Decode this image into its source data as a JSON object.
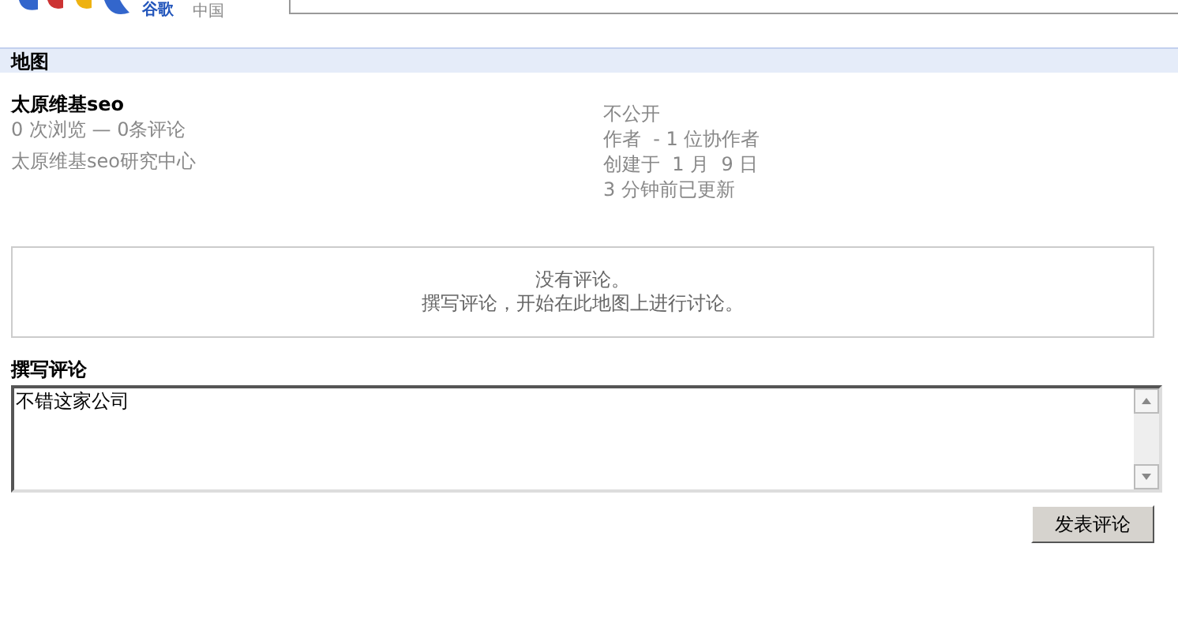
{
  "header": {
    "logo_sub": "谷歌",
    "region": "中国"
  },
  "section_title": "地图",
  "map": {
    "title": "太原维基seo",
    "stats": "0 次浏览 — 0条评论",
    "description": "太原维基seo研究中心",
    "visibility": "不公开",
    "author": "作者  - 1 位协作者",
    "created": "创建于  1 月  9 日",
    "updated": "3 分钟前已更新"
  },
  "comments": {
    "empty_lines": [
      "没有评论。",
      "撰写评论，开始在此地图上进行讨论。"
    ]
  },
  "compose": {
    "heading": "撰写评论",
    "value": "不错这家公司",
    "submit": "发表评论"
  }
}
